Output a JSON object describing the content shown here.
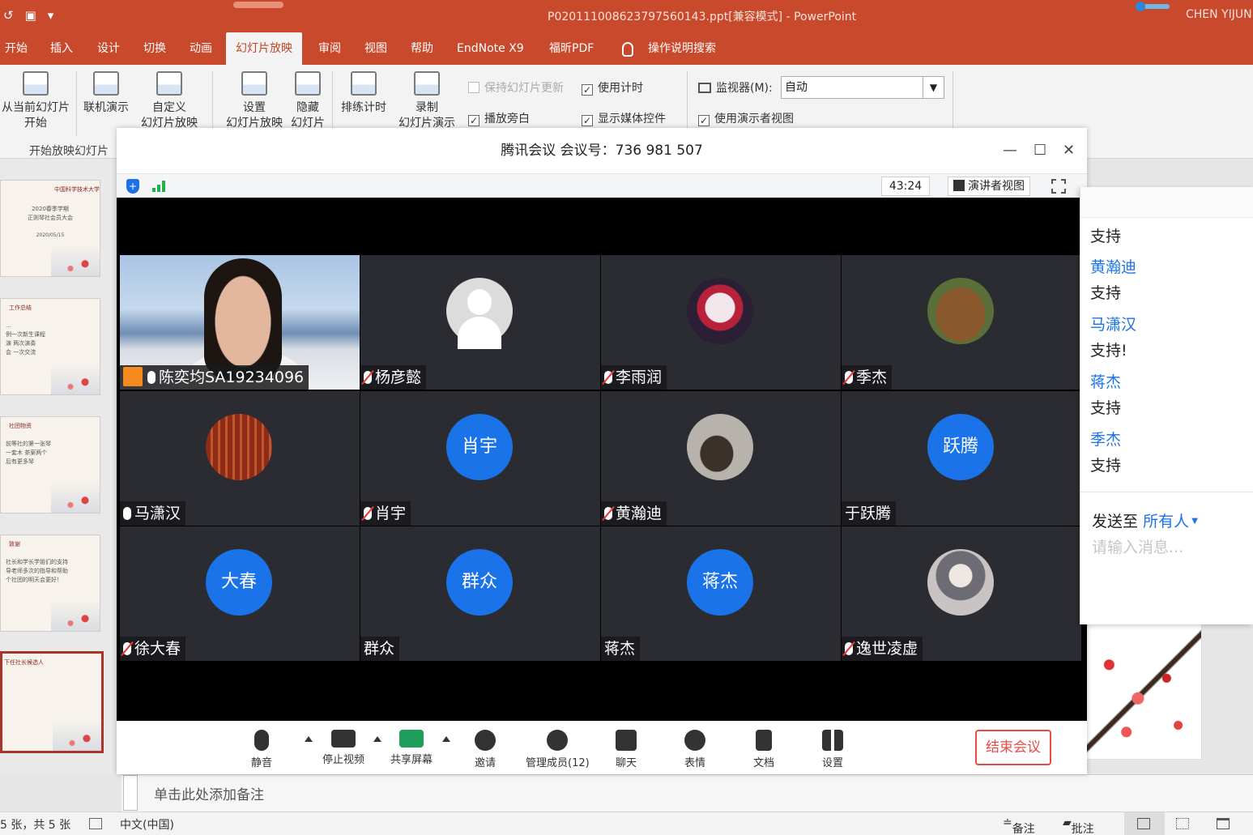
{
  "ppt": {
    "window_title": "P020111008623797560143.ppt[兼容模式]  -  PowerPoint",
    "user": "CHEN YIJUN",
    "tabs": [
      "开始",
      "插入",
      "设计",
      "切换",
      "动画",
      "幻灯片放映",
      "审阅",
      "视图",
      "帮助",
      "EndNote X9",
      "福昕PDF",
      "操作说明搜索"
    ],
    "active_tab": "幻灯片放映",
    "ribbon": {
      "from_current_line1": "从当前幻灯片",
      "from_current_line2": "开始",
      "online": "联机演示",
      "custom": "自定义",
      "custom_line2": "幻灯片放映",
      "setup": "设置",
      "setup_line2": "幻灯片放映",
      "hide": "隐藏",
      "hide_line2": "幻灯片",
      "rehearse": "排练计时",
      "record": "录制",
      "record_line2": "幻灯片演示",
      "keep_updated": "保持幻灯片更新",
      "use_timings": "使用计时",
      "play_narration": "播放旁白",
      "show_media": "显示媒体控件",
      "monitor_label": "监视器(M):",
      "monitor_value": "自动",
      "presenter_view": "使用演示者视图",
      "group_label": "开始放映幻灯片"
    },
    "thumbnails": [
      {
        "title": "中国科学技术大学",
        "lines": [
          "2020春季学期",
          "正则琴社会员大会",
          "2020/05/15"
        ]
      },
      {
        "title": "工作总结",
        "lines": [
          "...",
          "例一次新生课程",
          "演 两次演奏",
          "会 一次交流"
        ]
      },
      {
        "title": "社团物资",
        "lines": [
          "前等社的第一张琴",
          "一套木 茶案两个",
          "后有更多琴"
        ]
      },
      {
        "title": "致谢",
        "lines": [
          "社长和学长学姐们的支持",
          "导老师多次的指导和帮助",
          "个社团的明天会更好！"
        ]
      },
      {
        "title": "下任社长候选人",
        "lines": []
      }
    ],
    "notes_placeholder": "单击此处添加备注",
    "status": {
      "slide_count": "5 张，共 5 张",
      "language": "中文(中国)",
      "notes_btn": "备注",
      "comments_btn": "批注"
    }
  },
  "meeting": {
    "title": "腾讯会议 会议号：736 981 507",
    "timer": "43:24",
    "speaker_view": "演讲者视图",
    "participants": [
      {
        "name": "陈奕均SA19234096",
        "mic": "on",
        "type": "video",
        "host": true
      },
      {
        "name": "杨彦懿",
        "mic": "off",
        "type": "default"
      },
      {
        "name": "李雨润",
        "mic": "off",
        "type": "photo1"
      },
      {
        "name": "季杰",
        "mic": "off",
        "type": "photo2"
      },
      {
        "name": "马潇汉",
        "mic": "on",
        "type": "photo3"
      },
      {
        "name": "肖宇",
        "mic": "off",
        "type": "text",
        "avatar_text": "肖宇"
      },
      {
        "name": "黄瀚迪",
        "mic": "off",
        "type": "photo4"
      },
      {
        "name": "于跃腾",
        "mic": "none",
        "type": "text",
        "avatar_text": "跃腾"
      },
      {
        "name": "徐大春",
        "mic": "off",
        "type": "text",
        "avatar_text": "大春"
      },
      {
        "name": "群众",
        "mic": "none",
        "type": "text",
        "avatar_text": "群众"
      },
      {
        "name": "蒋杰",
        "mic": "none",
        "type": "text",
        "avatar_text": "蒋杰"
      },
      {
        "name": "逸世凌虚",
        "mic": "off",
        "type": "photo5"
      }
    ],
    "toolbar": {
      "mute": "静音",
      "stop_video": "停止视频",
      "share_screen": "共享屏幕",
      "invite": "邀请",
      "manage_members": "管理成员(12)",
      "chat": "聊天",
      "emoji": "表情",
      "docs": "文档",
      "settings": "设置",
      "end_meeting": "结束会议"
    },
    "chat": {
      "messages": [
        {
          "sender": "",
          "text": "支持"
        },
        {
          "sender": "黄瀚迪",
          "text": "支持"
        },
        {
          "sender": "马潇汉",
          "text": "支持!"
        },
        {
          "sender": "蒋杰",
          "text": "支持"
        },
        {
          "sender": "季杰",
          "text": "支持"
        }
      ],
      "send_to_label": "发送至",
      "send_to_target": "所有人",
      "input_placeholder": "请输入消息..."
    }
  },
  "colors": {
    "ppt_accent": "#c9492c",
    "meeting_blue": "#1a73e8",
    "end_red": "#e94b43"
  }
}
